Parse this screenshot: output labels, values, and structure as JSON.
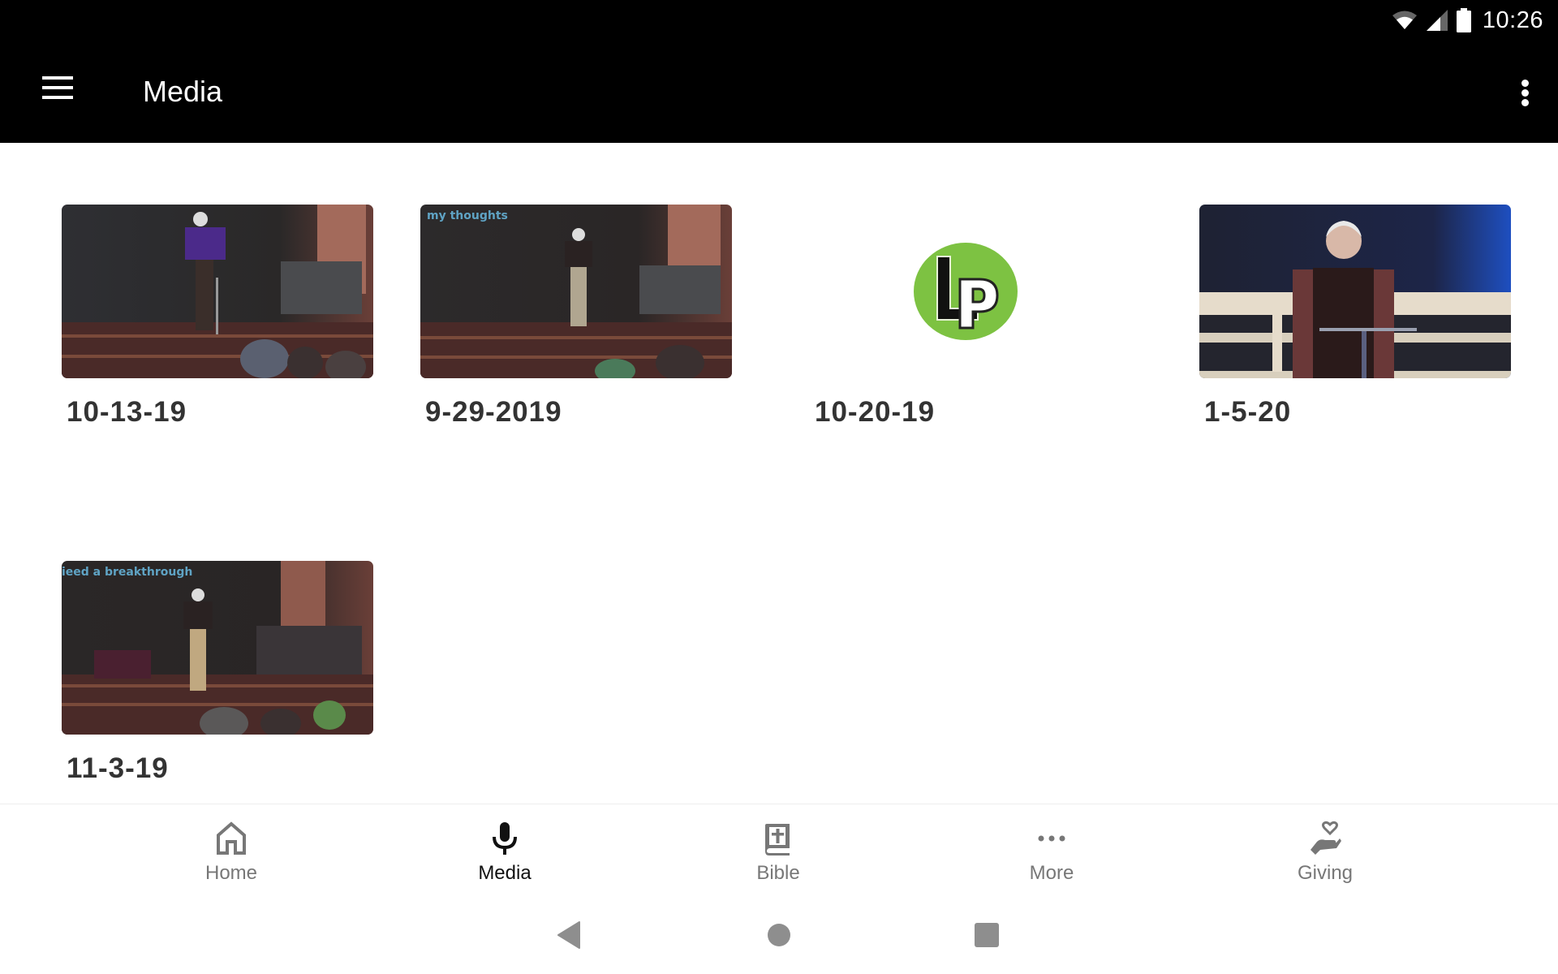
{
  "status_bar": {
    "time": "10:26",
    "icons": [
      "wifi-icon",
      "cell-signal-icon",
      "battery-icon"
    ]
  },
  "app_bar": {
    "title": "Media",
    "menu_icon": "hamburger-menu-icon",
    "overflow_icon": "more-vert-icon"
  },
  "media_items": [
    {
      "title": "10-13-19",
      "thumbnail": "sermon-stage-video",
      "overlay_text": ""
    },
    {
      "title": "9-29-2019",
      "thumbnail": "sermon-stage-video",
      "overlay_text": "my thoughts"
    },
    {
      "title": "10-20-19",
      "thumbnail": "lp-logo",
      "logo_text": "LP"
    },
    {
      "title": "1-5-20",
      "thumbnail": "sermon-seated-video",
      "overlay_text": ""
    },
    {
      "title": "11-3-19",
      "thumbnail": "sermon-stage-video",
      "overlay_text": "ieed a breakthrough"
    }
  ],
  "bottom_nav": {
    "items": [
      {
        "label": "Home",
        "icon": "home-icon",
        "active": false
      },
      {
        "label": "Media",
        "icon": "microphone-icon",
        "active": true
      },
      {
        "label": "Bible",
        "icon": "bible-icon",
        "active": false
      },
      {
        "label": "More",
        "icon": "more-horiz-icon",
        "active": false
      },
      {
        "label": "Giving",
        "icon": "giving-hand-heart-icon",
        "active": false
      }
    ]
  },
  "system_nav": [
    "back-icon",
    "home-circle-icon",
    "recents-icon"
  ],
  "colors": {
    "app_bar": "#000000",
    "active_nav": "#111111",
    "inactive_nav": "#777777",
    "title_text": "#333333",
    "lp_green": "#7dc242"
  }
}
